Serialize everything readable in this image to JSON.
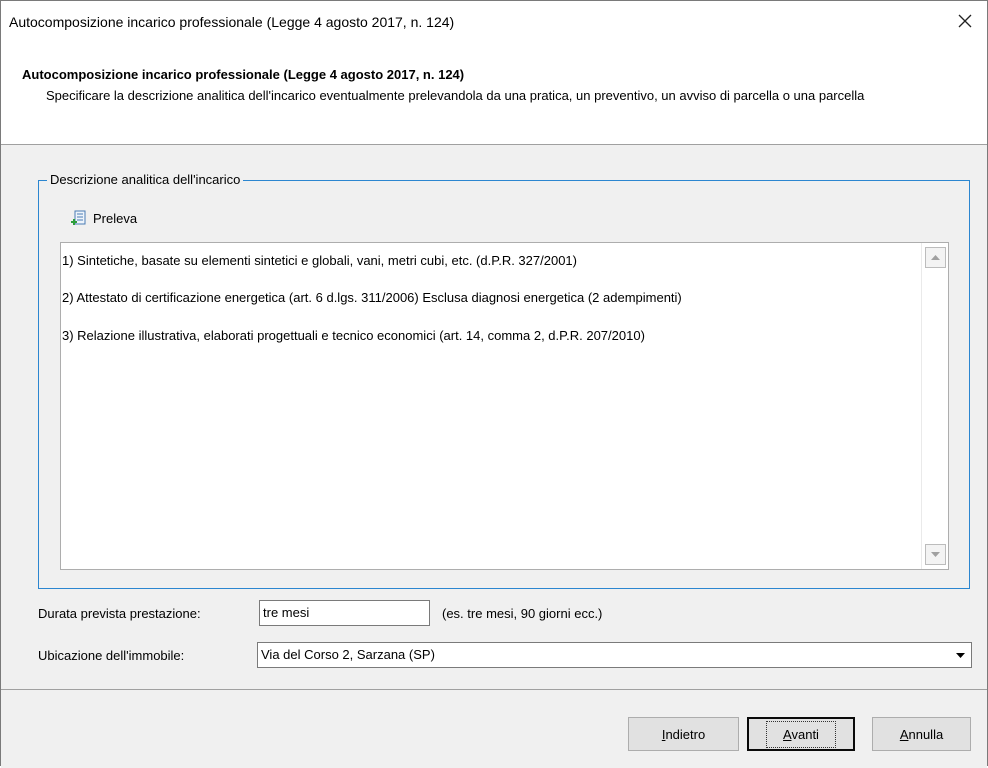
{
  "window": {
    "title": "Autocomposizione incarico professionale (Legge 4 agosto 2017, n. 124)",
    "close_icon": "close-icon"
  },
  "header": {
    "title": "Autocomposizione incarico professionale (Legge 4 agosto 2017, n. 124)",
    "subtitle": "Specificare la descrizione analitica dell'incarico eventualmente prelevandola da una pratica, un preventivo, un avviso di parcella o una parcella"
  },
  "group": {
    "legend": "Descrizione analitica dell'incarico",
    "preleva_label": "Preleva",
    "preleva_icon": "add-document-icon",
    "items": [
      "1) Sintetiche, basate su elementi sintetici e globali, vani, metri cubi, etc. (d.P.R. 327/2001)",
      "2) Attestato di certificazione energetica (art. 6 d.lgs. 311/2006) Esclusa diagnosi energetica (2 adempimenti)",
      "3) Relazione illustrativa, elaborati progettuali e tecnico economici (art. 14, comma 2, d.P.R. 207/2010)"
    ]
  },
  "form": {
    "durata_label": "Durata prevista prestazione:",
    "durata_value": "tre mesi",
    "durata_hint": "(es. tre mesi, 90 giorni ecc.)",
    "ubicazione_label": "Ubicazione dell'immobile:",
    "ubicazione_value": "Via del Corso 2, Sarzana (SP)"
  },
  "buttons": {
    "back": {
      "first": "I",
      "rest": "ndietro"
    },
    "next": {
      "first": "A",
      "rest": "vanti"
    },
    "cancel": {
      "first": "A",
      "rest": "nnulla"
    }
  },
  "colors": {
    "group_border": "#2b86d0",
    "panel_bg": "#f0f0f0"
  }
}
